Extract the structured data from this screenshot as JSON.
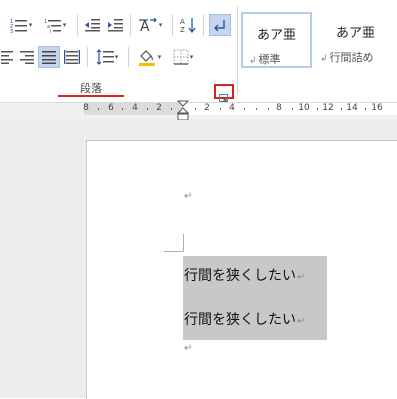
{
  "ribbon": {
    "paragraph_group": {
      "label": "段落",
      "launcher_icon": "dialog-launcher-icon",
      "accent_color": "#d42020",
      "buttons": [
        {
          "name": "numbering-button",
          "icon": "numbering-icon"
        },
        {
          "name": "multilevel-list-button",
          "icon": "multilevel-list-icon"
        },
        {
          "name": "decrease-indent-button",
          "icon": "decrease-indent-icon"
        },
        {
          "name": "increase-indent-button",
          "icon": "increase-indent-icon"
        },
        {
          "name": "asian-layout-button",
          "icon": "asian-layout-icon"
        },
        {
          "name": "sort-button",
          "icon": "sort-icon"
        },
        {
          "name": "show-marks-button",
          "icon": "paragraph-mark-icon",
          "active": true
        },
        {
          "name": "align-left-button",
          "icon": "align-left-icon"
        },
        {
          "name": "align-right-button",
          "icon": "align-right-icon"
        },
        {
          "name": "justify-button",
          "icon": "justify-icon",
          "active": true
        },
        {
          "name": "distributed-button",
          "icon": "distributed-icon"
        },
        {
          "name": "line-spacing-button",
          "icon": "line-spacing-icon"
        },
        {
          "name": "shading-button",
          "icon": "shading-icon"
        },
        {
          "name": "borders-button",
          "icon": "borders-icon"
        }
      ]
    },
    "styles": [
      {
        "sample": "あア亜",
        "name": "標準",
        "selected": true
      },
      {
        "sample": "あア亜",
        "name": "行間詰め",
        "selected": false
      }
    ]
  },
  "ruler": {
    "ticks": [
      "8",
      "6",
      "4",
      "2",
      "2",
      "4",
      "8",
      "10",
      "12",
      "14",
      "16"
    ]
  },
  "document": {
    "lines": [
      {
        "text": "",
        "mark": "↵"
      },
      {
        "text": "行間を狭くしたい",
        "mark": "↵",
        "selected": true
      },
      {
        "text": "行間を狭くしたい",
        "mark": "↵",
        "selected": true
      },
      {
        "text": "",
        "mark": "↵"
      }
    ],
    "selection_color": "#c8c8c8"
  }
}
